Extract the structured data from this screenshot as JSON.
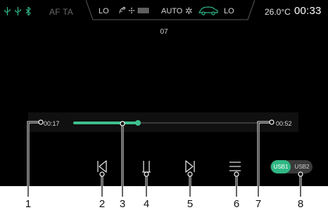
{
  "status_bar": {
    "icons": [
      "usb-icon",
      "usb-icon",
      "bluetooth-icon"
    ],
    "af_ta": "AF TA",
    "climate": {
      "left_temp": "LO",
      "fan_mode": "fan-recirc-icon",
      "fan_level": 7,
      "auto_label": "AUTO",
      "ac_icon": "ac-sun-icon",
      "car_icon": "car-airflow-icon",
      "right_temp": "LO"
    },
    "outside_temp": "26.0°C",
    "clock": "00:33"
  },
  "player": {
    "track_number": "07",
    "elapsed": "00:17",
    "total": "00:52",
    "progress": 0.33,
    "controls": {
      "prev": "previous-track-icon",
      "play_pause": "pause-icon",
      "next": "next-track-icon",
      "list": "playlist-icon"
    },
    "source": {
      "options": [
        "USB1",
        "USB2"
      ],
      "active": "USB1"
    }
  },
  "callouts": [
    "1",
    "2",
    "3",
    "4",
    "5",
    "6",
    "7",
    "8"
  ],
  "colors": {
    "accent": "#3dbf8d",
    "background": "#000000",
    "track": "#3a3a3a"
  }
}
